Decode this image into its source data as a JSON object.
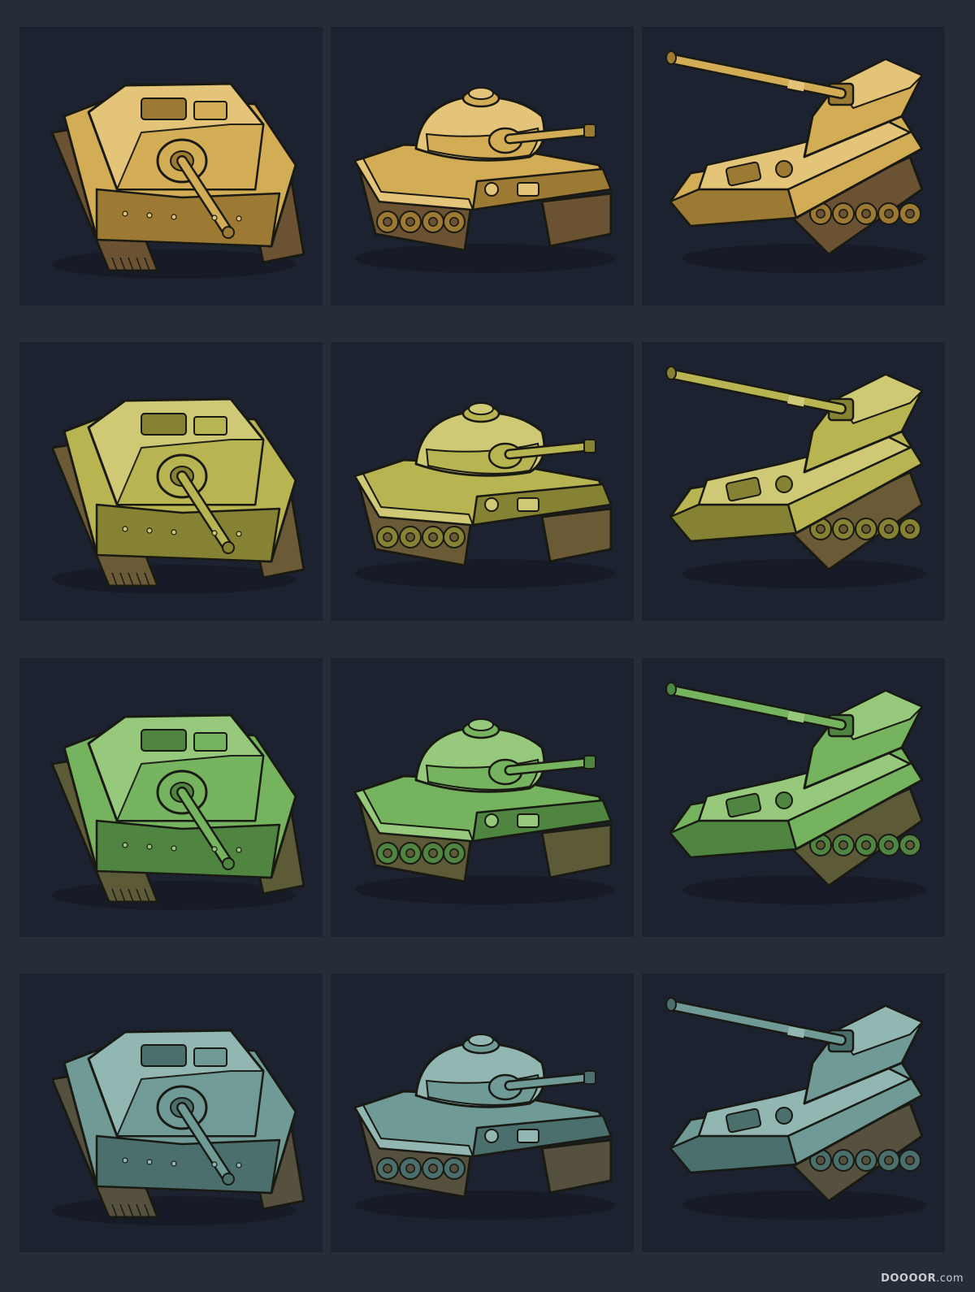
{
  "palette": {
    "page_bg": "#262c38",
    "tile_bg": "#1c2230",
    "outline": "#1a1a14",
    "rows": [
      {
        "body": "#d3ad55",
        "light": "#e3c478",
        "dark": "#9c7a33",
        "track": "#6a5232"
      },
      {
        "body": "#b8b452",
        "light": "#cfc975",
        "dark": "#868234",
        "track": "#6a5a36"
      },
      {
        "body": "#76b35e",
        "light": "#97c97c",
        "dark": "#4f8540",
        "track": "#5d5a38"
      },
      {
        "body": "#6f9a96",
        "light": "#92b7b2",
        "dark": "#4b6f6c",
        "track": "#55513e"
      }
    ]
  },
  "tiles": [
    {
      "row": 0,
      "col": 0,
      "kind": "casemate",
      "icon": "tank-destroyer-icon"
    },
    {
      "row": 0,
      "col": 1,
      "kind": "turret",
      "icon": "light-tank-icon"
    },
    {
      "row": 0,
      "col": 2,
      "kind": "spg",
      "icon": "self-propelled-gun-icon"
    },
    {
      "row": 1,
      "col": 0,
      "kind": "casemate",
      "icon": "tank-destroyer-icon"
    },
    {
      "row": 1,
      "col": 1,
      "kind": "turret",
      "icon": "medium-tank-icon"
    },
    {
      "row": 1,
      "col": 2,
      "kind": "spg",
      "icon": "self-propelled-gun-icon"
    },
    {
      "row": 2,
      "col": 0,
      "kind": "casemate",
      "icon": "tank-destroyer-icon"
    },
    {
      "row": 2,
      "col": 1,
      "kind": "turret",
      "icon": "medium-tank-icon"
    },
    {
      "row": 2,
      "col": 2,
      "kind": "spg",
      "icon": "self-propelled-gun-icon"
    },
    {
      "row": 3,
      "col": 0,
      "kind": "casemate",
      "icon": "tank-destroyer-icon"
    },
    {
      "row": 3,
      "col": 1,
      "kind": "turret",
      "icon": "heavy-tank-icon"
    },
    {
      "row": 3,
      "col": 2,
      "kind": "spg",
      "icon": "self-propelled-gun-icon"
    }
  ],
  "watermark": {
    "brand": "DOOOOR",
    "suffix": ".com"
  }
}
